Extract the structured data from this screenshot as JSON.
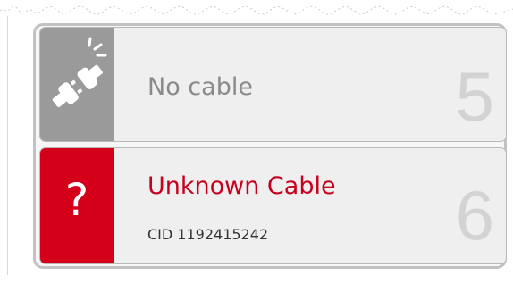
{
  "colors": {
    "disconnected_tile": "#9a9a9a",
    "error_tile": "#d4001a",
    "error_text": "#c8001e",
    "muted_text": "#8a8a8a",
    "card_background": "#efefef",
    "port_number": "#d3d3d3"
  },
  "ports": [
    {
      "number": "5",
      "icon": "unplugged-cable-icon",
      "status": "No cable"
    },
    {
      "number": "6",
      "icon": "question-mark-icon",
      "icon_text": "?",
      "status": "Unknown Cable",
      "detail": "CID 1192415242"
    }
  ]
}
